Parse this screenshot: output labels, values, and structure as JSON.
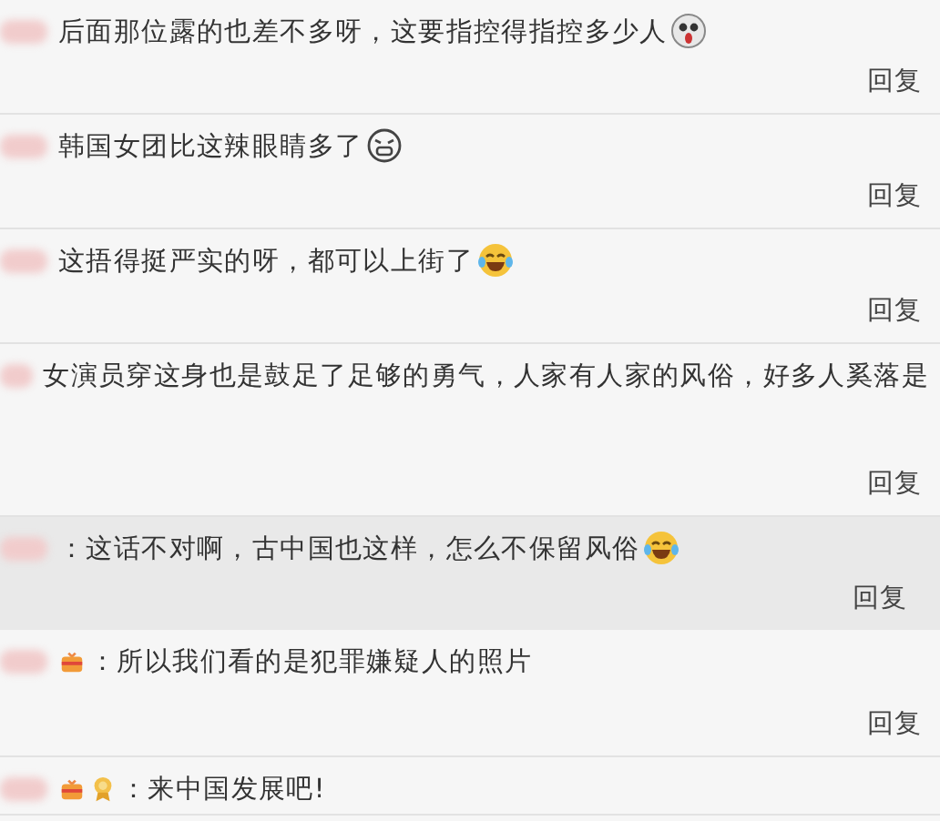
{
  "comments": [
    {
      "text": "后面那位露的也差不多呀，这要指控得指控多少人",
      "emoji": {
        "kind": "shocked"
      },
      "highlighted": false,
      "reply": "回复"
    },
    {
      "text": "韩国女团比这辣眼睛多了",
      "emoji": {
        "kind": "grimace"
      },
      "highlighted": false,
      "reply": "回复"
    },
    {
      "text": "这捂得挺严实的呀，都可以上街了",
      "emoji": {
        "kind": "laugh-cry"
      },
      "highlighted": false,
      "reply": "回复"
    },
    {
      "text": "女演员穿这身也是鼓足了足够的勇气，人家有人家的风俗，好多人奚落是",
      "highlighted": false,
      "reply": "回复"
    },
    {
      "text": "：这话不对啊，古中国也这样，怎么不保留风俗",
      "emoji": {
        "kind": "laugh-cry"
      },
      "highlighted": true,
      "reply": "回复"
    },
    {
      "text": "：所以我们看的是犯罪嫌疑人的照片",
      "badges": [
        {
          "kind": "gift"
        }
      ],
      "highlighted": false,
      "reply": "回复"
    },
    {
      "text": "：来中国发展吧!",
      "badges": [
        {
          "kind": "gift"
        },
        {
          "kind": "medal"
        }
      ],
      "highlighted": false
    }
  ]
}
